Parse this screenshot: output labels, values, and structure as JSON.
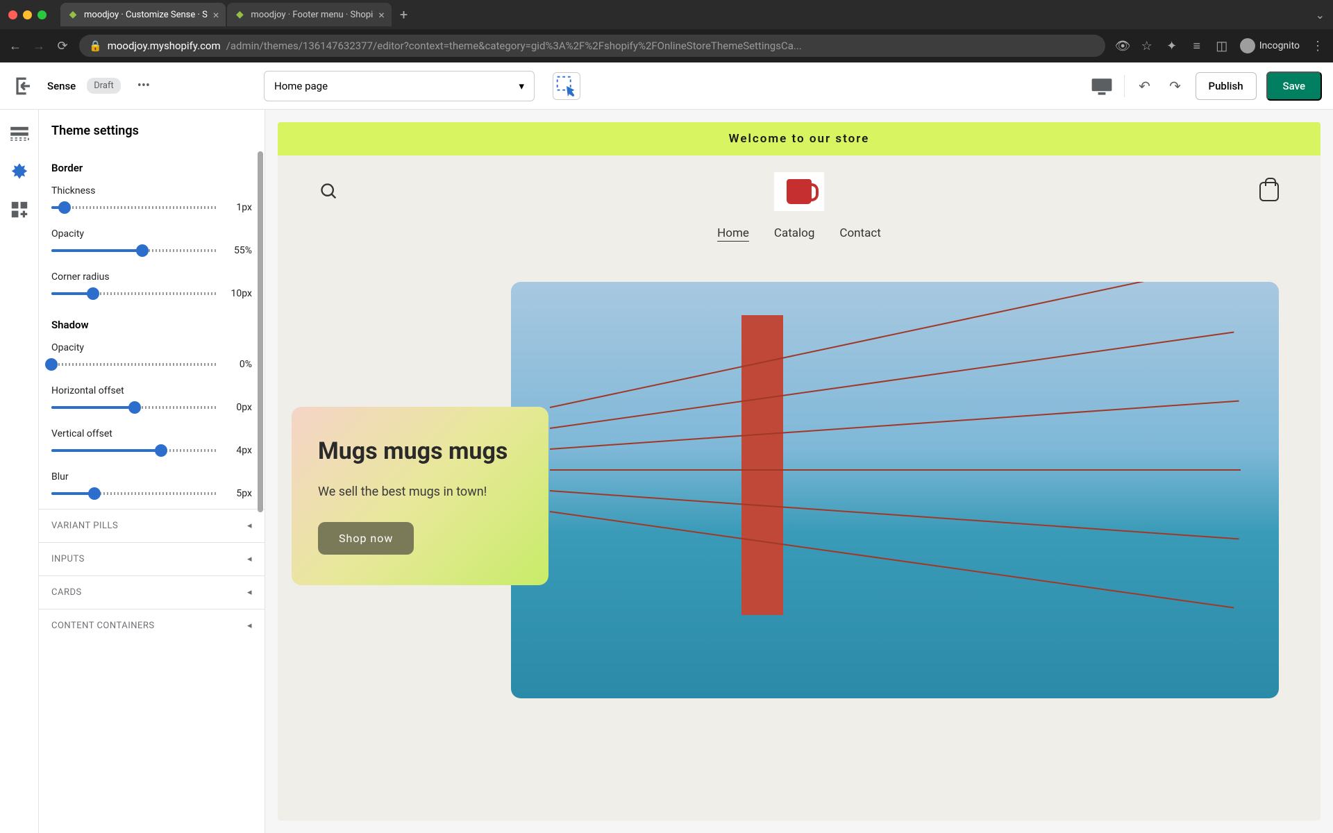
{
  "browser": {
    "tabs": [
      {
        "title": "moodjoy · Customize Sense · S",
        "active": true
      },
      {
        "title": "moodjoy · Footer menu · Shopi",
        "active": false
      }
    ],
    "url_domain": "moodjoy.myshopify.com",
    "url_path": "/admin/themes/136147632377/editor?context=theme&category=gid%3A%2F%2Fshopify%2FOnlineStoreThemeSettingsCa...",
    "incognito_label": "Incognito"
  },
  "topbar": {
    "theme_name": "Sense",
    "draft_label": "Draft",
    "page_select": "Home page",
    "publish_label": "Publish",
    "save_label": "Save"
  },
  "sidebar": {
    "title": "Theme settings",
    "border_label": "Border",
    "shadow_label": "Shadow",
    "sliders": {
      "thickness": {
        "label": "Thickness",
        "value": "1px",
        "pct": 8
      },
      "opacity": {
        "label": "Opacity",
        "value": "55%",
        "pct": 55
      },
      "corner_radius": {
        "label": "Corner radius",
        "value": "10px",
        "pct": 25
      },
      "shadow_opacity": {
        "label": "Opacity",
        "value": "0%",
        "pct": 0
      },
      "hoffset": {
        "label": "Horizontal offset",
        "value": "0px",
        "pct": 50
      },
      "voffset": {
        "label": "Vertical offset",
        "value": "4px",
        "pct": 66
      },
      "blur": {
        "label": "Blur",
        "value": "5px",
        "pct": 26
      }
    },
    "accordions": {
      "variant_pills": "VARIANT PILLS",
      "inputs": "INPUTS",
      "cards": "CARDS",
      "content_containers": "CONTENT CONTAINERS"
    }
  },
  "preview": {
    "announcement": "Welcome to our store",
    "nav": {
      "home": "Home",
      "catalog": "Catalog",
      "contact": "Contact"
    },
    "hero": {
      "title": "Mugs mugs mugs",
      "subtitle": "We sell the best mugs in town!",
      "cta": "Shop now"
    }
  }
}
